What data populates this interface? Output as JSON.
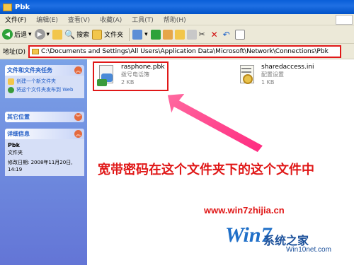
{
  "window": {
    "title": "Pbk"
  },
  "menu": [
    "文件(F)",
    "编辑(E)",
    "查看(V)",
    "收藏(A)",
    "工具(T)",
    "帮助(H)"
  ],
  "toolbar": {
    "back": "后退",
    "search": "搜索",
    "folders": "文件夹"
  },
  "address": {
    "label": "地址(D)",
    "path": "C:\\Documents and Settings\\All Users\\Application Data\\Microsoft\\Network\\Connections\\Pbk"
  },
  "sidebar": {
    "tasks_title": "文件和文件夹任务",
    "task1": "创建一个新文件夹",
    "task2": "将这个文件夹发布到 Web",
    "other_title": "其它位置",
    "details_title": "详细信息",
    "details_name": "Pbk",
    "details_type": "文件夹",
    "details_modified": "修改日期: 2008年11月20日, 14:19"
  },
  "files": [
    {
      "name": "rasphone.pbk",
      "type": "拨号电话簿",
      "size": "2 KB"
    },
    {
      "name": "sharedaccess.ini",
      "type": "配置设置",
      "size": "1 KB"
    }
  ],
  "annotation": {
    "caption": "宽带密码在这个文件夹下的这个文件中",
    "color": "#e01818"
  },
  "watermark": {
    "url": "www.win7zhijia.cn",
    "brand": "系统之家",
    "site": "Win10net.com",
    "logo": "Win7"
  },
  "colors": {
    "titlebar": "#0a5fd8",
    "sidebar": "#7ba2e7",
    "accent": "#e01818"
  }
}
